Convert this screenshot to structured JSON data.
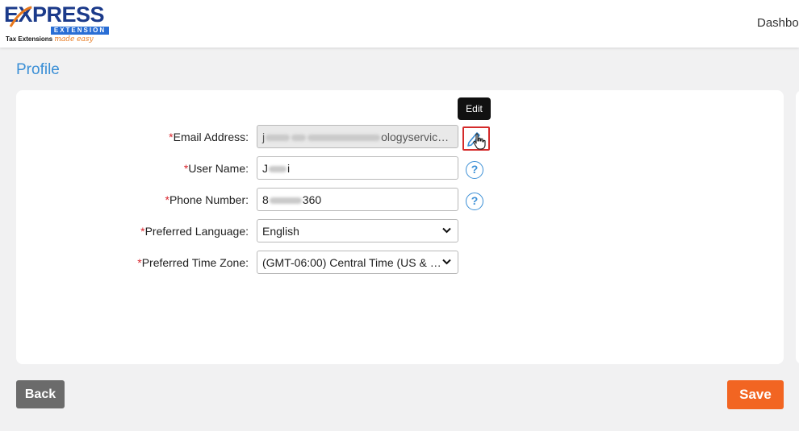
{
  "brand": {
    "name": "EXPRESS",
    "sub": "EXTENSION",
    "tagline": "Tax Extensions",
    "tagline_script": "made easy",
    "colors": {
      "primary": "#1b3a8a",
      "accent": "#2a6ed5",
      "orange": "#e8781c"
    }
  },
  "header": {
    "nav_label": "Dashbo"
  },
  "page": {
    "title": "Profile"
  },
  "form": {
    "required_mark": "*",
    "email": {
      "label": "Email Address:",
      "value_suffix": "ologyservic…"
    },
    "username": {
      "label": "User Name:"
    },
    "phone": {
      "label": "Phone Number:",
      "value_prefix": "8",
      "value_suffix": "360"
    },
    "language": {
      "label": "Preferred Language:",
      "value": "English"
    },
    "timezone": {
      "label": "Preferred Time Zone:",
      "value": "(GMT-06:00) Central Time (US & …"
    }
  },
  "tooltip": {
    "edit": "Edit"
  },
  "icons": {
    "edit": "pencil-icon",
    "help": "help-icon",
    "caret": "chevron-down-icon",
    "cursor": "hand-pointer-icon"
  },
  "help_symbol": "?",
  "buttons": {
    "back": "Back",
    "save": "Save"
  },
  "colors": {
    "link": "#3b8fd6",
    "required": "#d9262e",
    "save": "#f26522",
    "back": "#6b6b6b"
  }
}
